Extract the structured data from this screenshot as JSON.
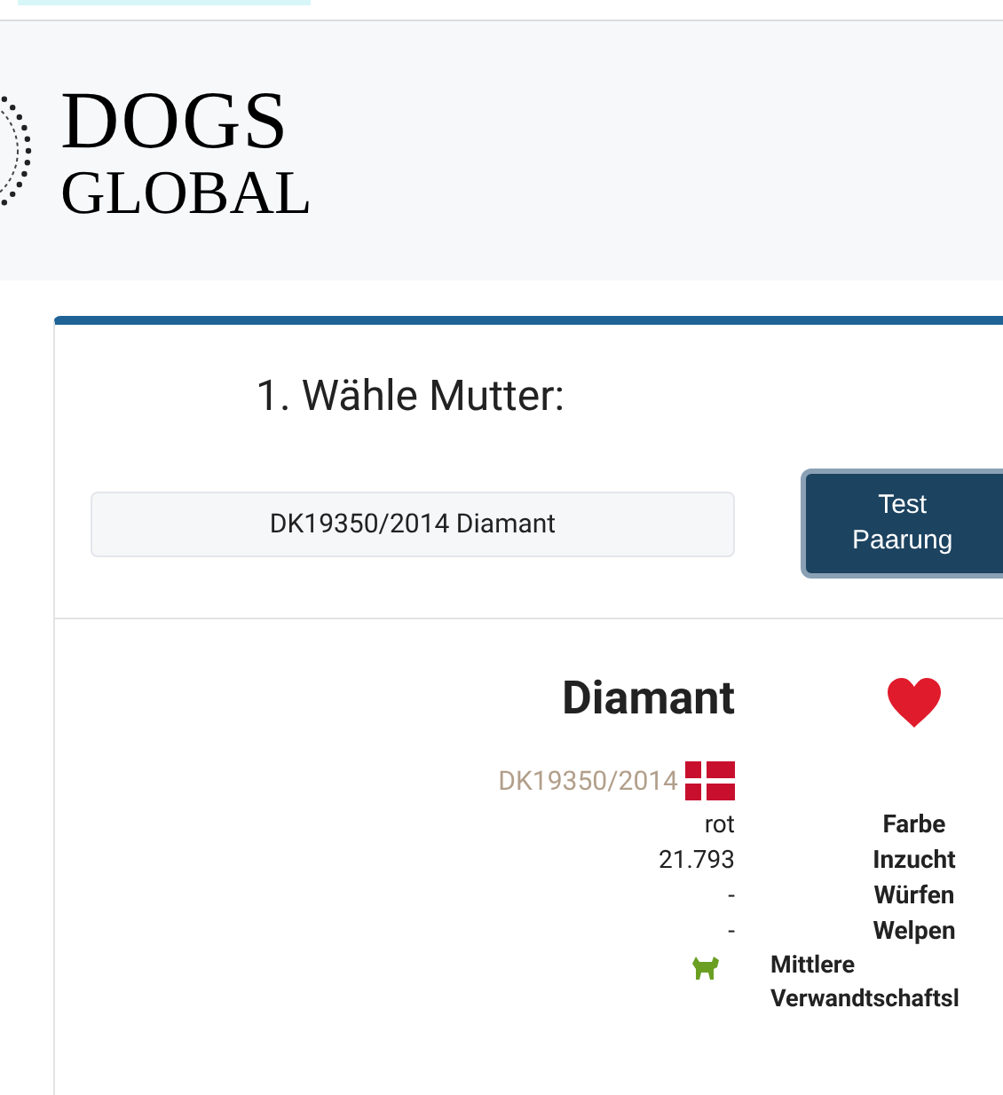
{
  "header": {
    "logo_line_1": "DOGS",
    "logo_line_2": "GLOBAL"
  },
  "selector": {
    "title": "1. Wähle Mutter:",
    "field_value": "DK19350/2014 Diamant",
    "button": "Test Paarung"
  },
  "dog": {
    "name": "Diamant",
    "registration": "DK19350/2014",
    "facts": [
      {
        "kind": "text",
        "value": "rot",
        "label": "Farbe"
      },
      {
        "kind": "text",
        "value": "21.793",
        "label": "Inzucht"
      },
      {
        "kind": "text",
        "value": "-",
        "label": "Würfen"
      },
      {
        "kind": "text",
        "value": "-",
        "label": "Welpen"
      },
      {
        "kind": "icon",
        "label": "Mittlere Verwandtschaftsl"
      }
    ]
  }
}
